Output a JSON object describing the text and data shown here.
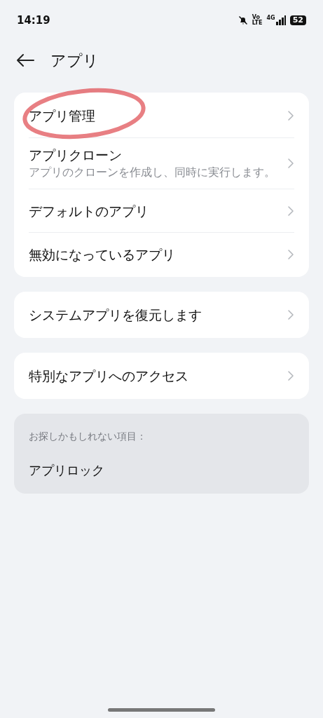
{
  "status_bar": {
    "time": "14:19",
    "volte": [
      "Vo",
      "LTE"
    ],
    "network": "4G",
    "battery": "52"
  },
  "header": {
    "title": "アプリ"
  },
  "groups": [
    {
      "items": [
        {
          "label": "アプリ管理"
        },
        {
          "label": "アプリクローン",
          "description": "アプリのクローンを作成し、同時に実行します。"
        },
        {
          "label": "デフォルトのアプリ"
        },
        {
          "label": "無効になっているアプリ"
        }
      ]
    },
    {
      "items": [
        {
          "label": "システムアプリを復元します"
        }
      ]
    },
    {
      "items": [
        {
          "label": "特別なアプリへのアクセス"
        }
      ]
    }
  ],
  "suggestions": {
    "heading": "お探しかもしれない項目：",
    "items": [
      "アプリロック"
    ]
  }
}
